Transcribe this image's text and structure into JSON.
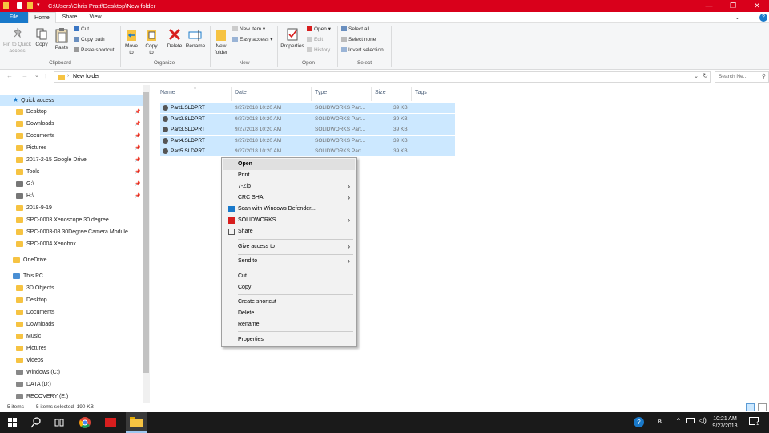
{
  "window": {
    "path": "C:\\Users\\Chris Pratt\\Desktop\\New folder",
    "minimize": "—",
    "maximize": "❐",
    "close": "✕",
    "help": "?"
  },
  "tabs": [
    "File",
    "Home",
    "Share",
    "View"
  ],
  "ribbon": {
    "clipboard": {
      "pin_label": "Pin to Quick access",
      "copy": "Copy",
      "paste": "Paste",
      "cut": "Cut",
      "copy_path": "Copy path",
      "paste_shortcut": "Paste shortcut",
      "group": "Clipboard"
    },
    "organize": {
      "move_to": "Move to",
      "copy_to": "Copy to",
      "delete": "Delete",
      "rename": "Rename",
      "group": "Organize"
    },
    "new": {
      "new_folder": "New folder",
      "new_item": "New item",
      "easy_access": "Easy access",
      "group": "New"
    },
    "open": {
      "properties": "Properties",
      "open": "Open",
      "edit": "Edit",
      "history": "History",
      "group": "Open"
    },
    "select": {
      "select_all": "Select all",
      "select_none": "Select none",
      "invert": "Invert selection",
      "group": "Select"
    }
  },
  "address": {
    "crumb": "New folder",
    "search_placeholder": "Search Ne..."
  },
  "nav": {
    "quick_access": "Quick access",
    "quick_items": [
      "Desktop",
      "Downloads",
      "Documents",
      "Pictures",
      "2017-2-15 Google Drive",
      "Tools",
      "G:\\",
      "H:\\",
      "2018-9-19",
      "SPC-0003 Xenoscope 30 degree",
      "SPC-0003-08 30Degree Camera Module",
      "SPC-0004 Xenobox"
    ],
    "onedrive": "OneDrive",
    "this_pc": "This PC",
    "pc_items": [
      "3D Objects",
      "Desktop",
      "Documents",
      "Downloads",
      "Music",
      "Pictures",
      "Videos",
      "Windows (C:)",
      "DATA (D:)",
      "RECOVERY (E:)"
    ]
  },
  "columns": {
    "name": "Name",
    "date": "Date",
    "type": "Type",
    "size": "Size",
    "tags": "Tags"
  },
  "files": [
    {
      "name": "Part1.SLDPRT",
      "date": "9/27/2018 10:20 AM",
      "type": "SOLIDWORKS Part...",
      "size": "39 KB"
    },
    {
      "name": "Part2.SLDPRT",
      "date": "9/27/2018 10:20 AM",
      "type": "SOLIDWORKS Part...",
      "size": "39 KB"
    },
    {
      "name": "Part3.SLDPRT",
      "date": "9/27/2018 10:20 AM",
      "type": "SOLIDWORKS Part...",
      "size": "39 KB"
    },
    {
      "name": "Part4.SLDPRT",
      "date": "9/27/2018 10:20 AM",
      "type": "SOLIDWORKS Part...",
      "size": "39 KB"
    },
    {
      "name": "Part5.SLDPRT",
      "date": "9/27/2018 10:20 AM",
      "type": "SOLIDWORKS Part...",
      "size": "39 KB"
    }
  ],
  "context_menu": {
    "open": "Open",
    "print": "Print",
    "zip": "7-Zip",
    "crc": "CRC SHA",
    "defender": "Scan with Windows Defender...",
    "solidworks": "SOLIDWORKS",
    "share": "Share",
    "give_access": "Give access to",
    "send_to": "Send to",
    "cut": "Cut",
    "copy": "Copy",
    "create_shortcut": "Create shortcut",
    "delete": "Delete",
    "rename": "Rename",
    "properties": "Properties"
  },
  "status": {
    "items": "5 items",
    "selected": "5 items selected  190 KB"
  },
  "taskbar": {
    "time": "10:21 AM",
    "date": "9/27/2018",
    "notify_count": "1"
  },
  "colors": {
    "titlebar": "#d9001b",
    "file_tab": "#1979ca",
    "selection": "#cce8ff",
    "taskbar": "#1a1a1a"
  }
}
